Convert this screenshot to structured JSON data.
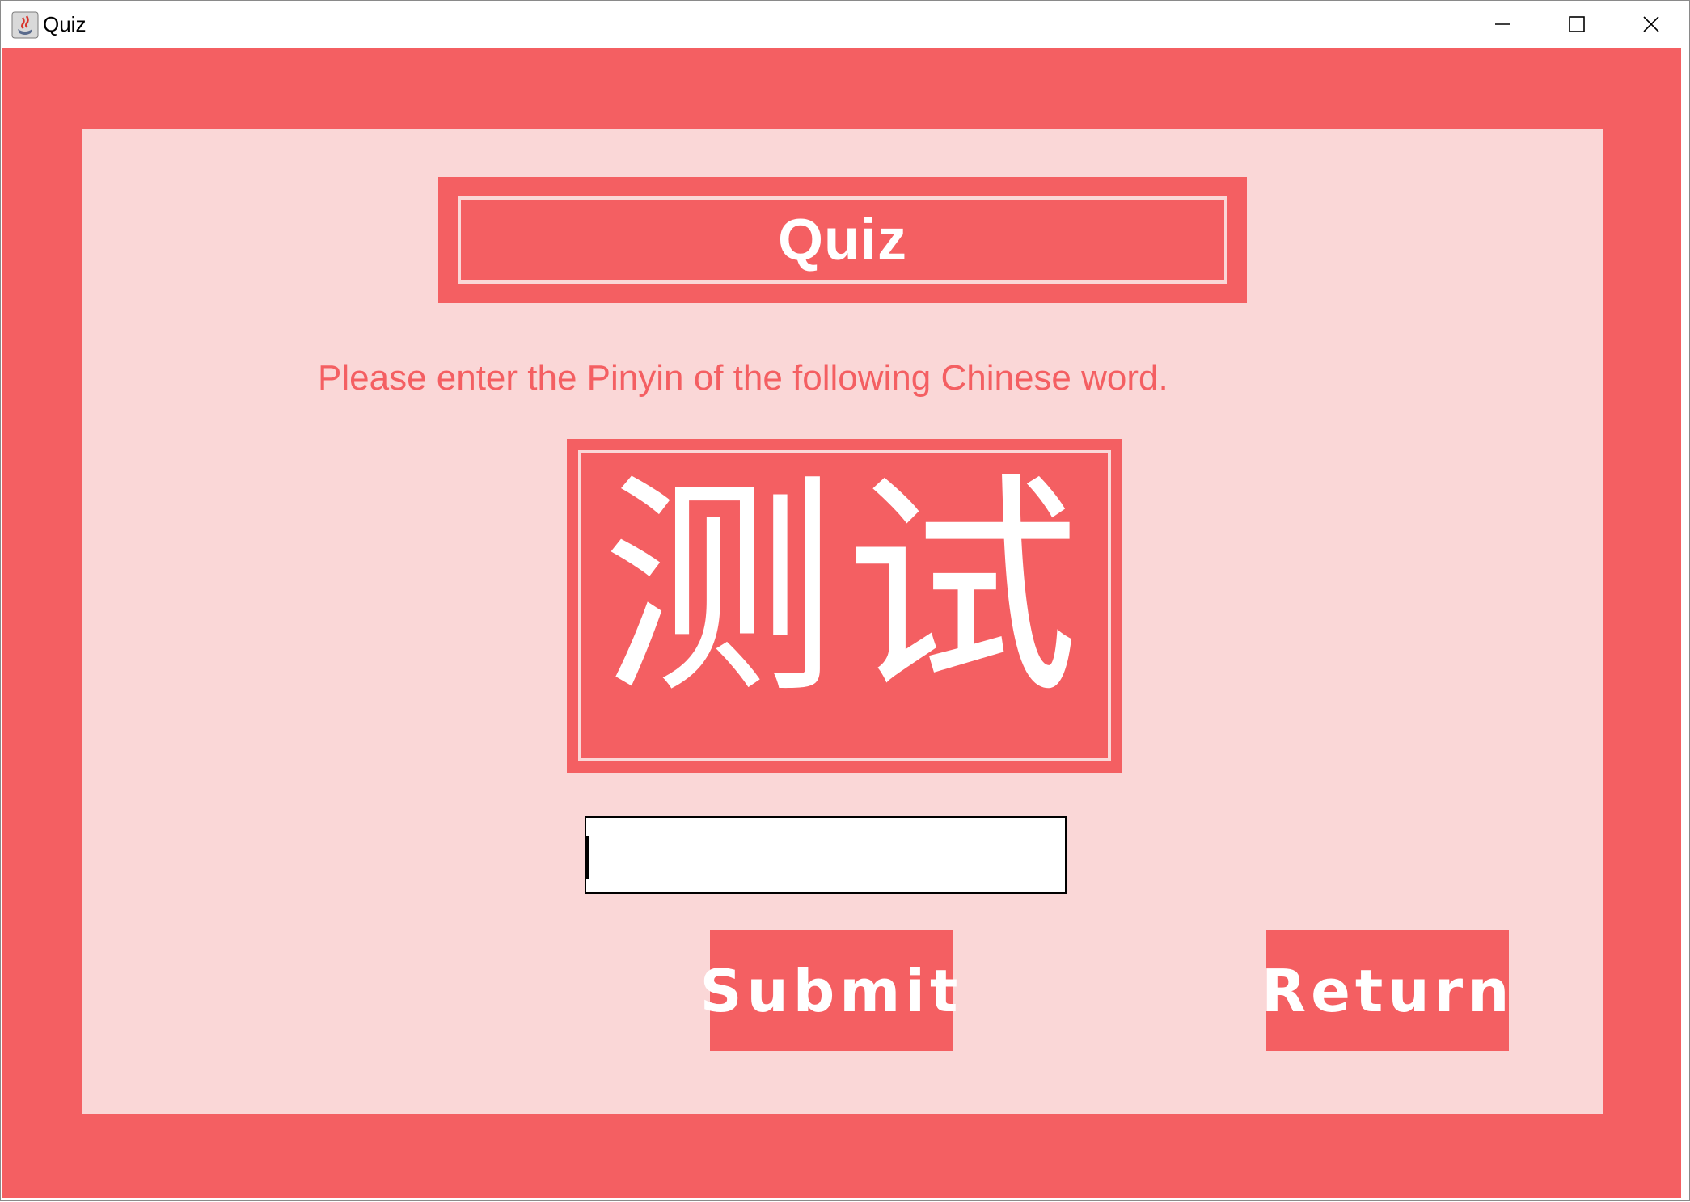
{
  "window": {
    "title": "Quiz",
    "app_icon": "java-coffee-cup-icon",
    "controls": [
      "minimize-icon",
      "maximize-icon",
      "close-icon"
    ]
  },
  "colors": {
    "frame": "#f45f62",
    "panel": "#fad7d7",
    "text_light": "#ffffff"
  },
  "quiz": {
    "heading": "Quiz",
    "instruction": "Please enter the Pinyin of the following Chinese word.",
    "word": "测试",
    "answer_value": "",
    "submit_label": "Submit",
    "return_label": "Return"
  }
}
